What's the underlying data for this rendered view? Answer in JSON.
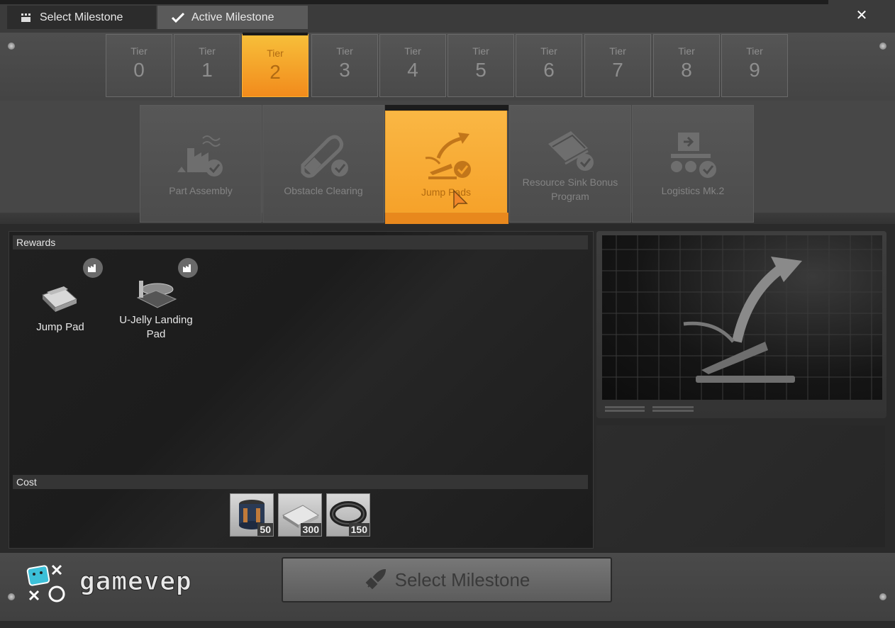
{
  "header": {
    "tabs": [
      {
        "label": "Select Milestone",
        "icon": "grid-icon"
      },
      {
        "label": "Active Milestone",
        "icon": "check-icon"
      }
    ],
    "close_label": "✕"
  },
  "tiers": [
    {
      "label": "Tier",
      "number": "0"
    },
    {
      "label": "Tier",
      "number": "1"
    },
    {
      "label": "Tier",
      "number": "2",
      "selected": true
    },
    {
      "label": "Tier",
      "number": "3"
    },
    {
      "label": "Tier",
      "number": "4"
    },
    {
      "label": "Tier",
      "number": "5"
    },
    {
      "label": "Tier",
      "number": "6"
    },
    {
      "label": "Tier",
      "number": "7"
    },
    {
      "label": "Tier",
      "number": "8"
    },
    {
      "label": "Tier",
      "number": "9"
    }
  ],
  "milestones": [
    {
      "name": "Part Assembly",
      "icon": "factory-icon",
      "completed": true
    },
    {
      "name": "Obstacle Clearing",
      "icon": "chainsaw-icon",
      "completed": true
    },
    {
      "name": "Jump Pads",
      "icon": "jump-pad-icon",
      "completed": true,
      "selected": true
    },
    {
      "name": "Resource Sink Bonus Program",
      "icon": "ticket-icon",
      "completed": true
    },
    {
      "name": "Logistics Mk.2",
      "icon": "conveyor-icon",
      "completed": true
    }
  ],
  "rewards": {
    "header": "Rewards",
    "items": [
      {
        "name": "Jump Pad",
        "badge_icon": "factory-badge-icon"
      },
      {
        "name": "U-Jelly Landing Pad",
        "badge_icon": "factory-badge-icon"
      }
    ]
  },
  "cost": {
    "header": "Cost",
    "items": [
      {
        "item": "rotor",
        "amount": "50"
      },
      {
        "item": "iron-plate",
        "amount": "300"
      },
      {
        "item": "cable",
        "amount": "150"
      }
    ]
  },
  "action": {
    "label": "Select Milestone",
    "icon": "rocket-icon"
  },
  "branding": {
    "logo_text": "gamevep"
  },
  "colors": {
    "accent": "#f6a22a",
    "panel": "#4c4c4c",
    "background": "#1c1c1c"
  }
}
